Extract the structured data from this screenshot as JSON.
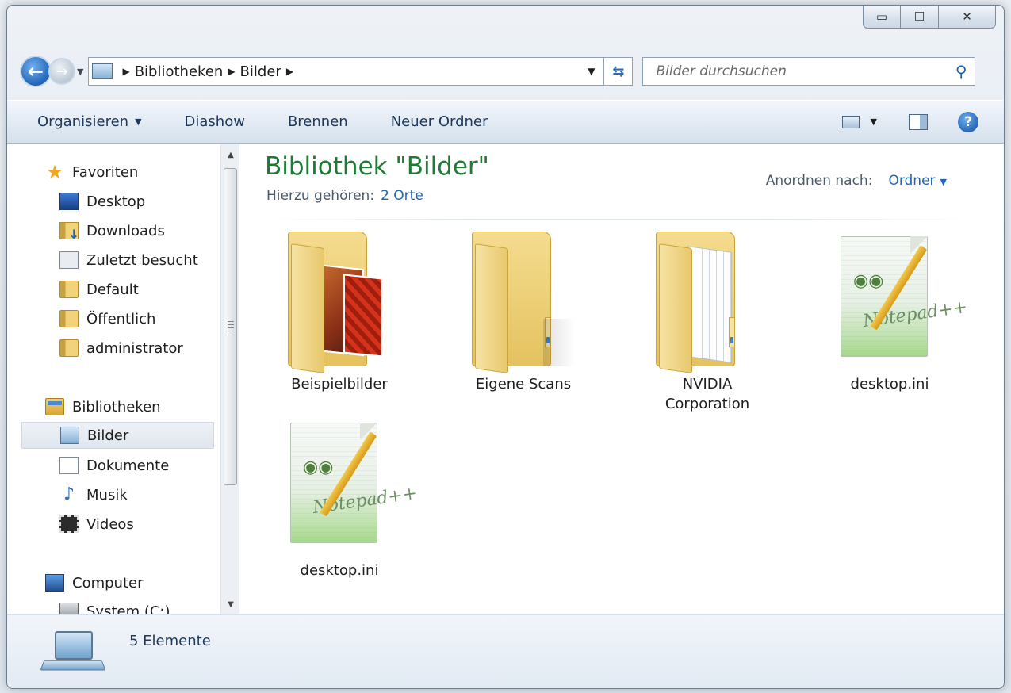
{
  "window": {
    "caption_buttons": {
      "minimize": "▭",
      "maximize": "☐",
      "close": "✕"
    }
  },
  "address": {
    "breadcrumbs": [
      "Bibliotheken",
      "Bilder"
    ],
    "search_placeholder": "Bilder durchsuchen"
  },
  "toolbar": {
    "organize": "Organisieren",
    "slideshow": "Diashow",
    "burn": "Brennen",
    "new_folder": "Neuer Ordner"
  },
  "nav": {
    "favorites": {
      "label": "Favoriten",
      "items": [
        "Desktop",
        "Downloads",
        "Zuletzt besucht",
        "Default",
        "Öffentlich",
        "administrator"
      ]
    },
    "libraries": {
      "label": "Bibliotheken",
      "items": [
        "Bilder",
        "Dokumente",
        "Musik",
        "Videos"
      ],
      "selected": "Bilder"
    },
    "computer": {
      "label": "Computer",
      "items": [
        "System (C:)"
      ]
    }
  },
  "content": {
    "title": "Bibliothek \"Bilder\"",
    "includes_label": "Hierzu gehören:",
    "includes_link": "2 Orte",
    "arrange_label": "Anordnen nach:",
    "arrange_value": "Ordner",
    "items": [
      {
        "name": "Beispielbilder",
        "type": "folder-pictures"
      },
      {
        "name": "Eigene Scans",
        "type": "folder"
      },
      {
        "name": "NVIDIA Corporation",
        "type": "folder-documents"
      },
      {
        "name": "desktop.ini",
        "type": "notepad-file"
      },
      {
        "name": "desktop.ini",
        "type": "notepad-file"
      }
    ]
  },
  "status": {
    "count": "5 Elemente"
  }
}
